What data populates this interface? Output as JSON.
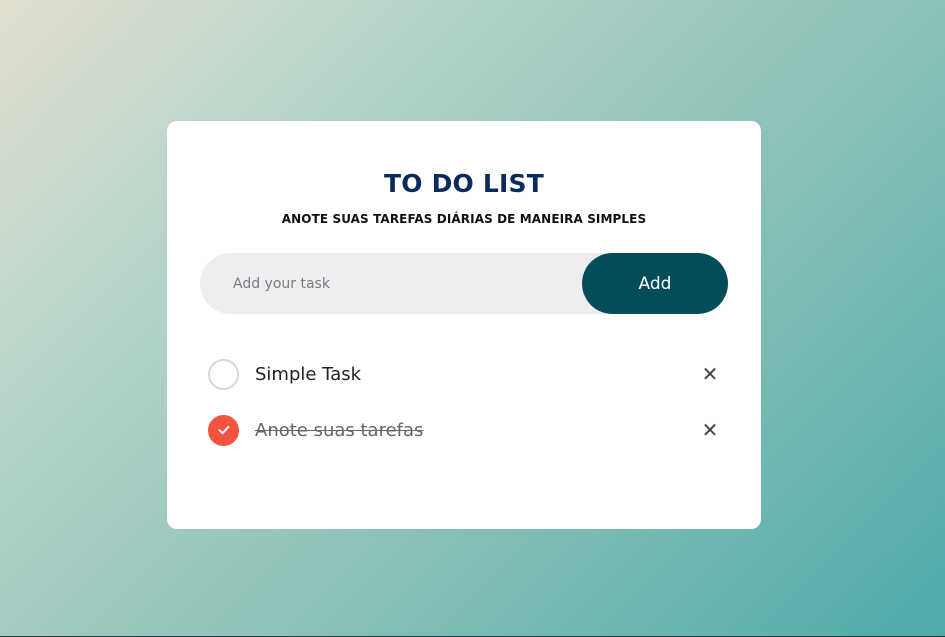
{
  "header": {
    "title": "TO DO LIST",
    "subtitle": "ANOTE SUAS TAREFAS DIÁRIAS DE MANEIRA SIMPLES"
  },
  "input": {
    "placeholder": "Add your task",
    "value": "",
    "add_label": "Add"
  },
  "tasks": [
    {
      "text": "Simple Task",
      "completed": false,
      "delete_icon": "close-icon"
    },
    {
      "text": "Anote suas tarefas",
      "completed": true,
      "delete_icon": "close-icon"
    }
  ],
  "colors": {
    "title": "#0b2b5c",
    "add_button": "#034d5a",
    "checked": "#f4543f"
  }
}
